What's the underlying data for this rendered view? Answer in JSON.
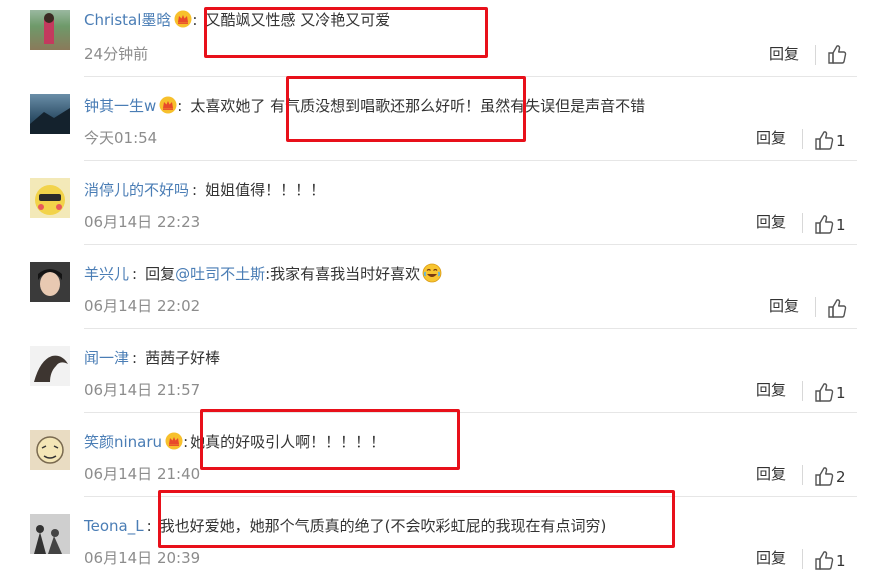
{
  "comments": [
    {
      "user": "Christal墨晗",
      "crown": true,
      "text": "又酷飒又性感 又冷艳又可爱",
      "time": "24分钟前",
      "reply": "回复",
      "likes": ""
    },
    {
      "user": "钟其一生w",
      "crown": true,
      "text": "太喜欢她了  有气质没想到唱歌还那么好听！虽然有失误但是声音不错",
      "time": "今天01:54",
      "reply": "回复",
      "likes": "1"
    },
    {
      "user": "消停儿的不好吗",
      "crown": false,
      "text": "姐姐值得！！！！",
      "time": "06月14日 22:23",
      "reply": "回复",
      "likes": "1"
    },
    {
      "user": "羊兴儿",
      "crown": false,
      "reply_prefix": "回复",
      "mention": "@吐司不土斯",
      "text": ":我家有喜我当时好喜欢",
      "emoji": "laugh-cry-emoji",
      "time": "06月14日 22:02",
      "reply": "回复",
      "likes": ""
    },
    {
      "user": "闻一津",
      "crown": false,
      "text": "茜茜子好棒",
      "time": "06月14日 21:57",
      "reply": "回复",
      "likes": "1"
    },
    {
      "user": "笑颜ninaru",
      "crown": true,
      "text": "她真的好吸引人啊！！！！！",
      "time": "06月14日 21:40",
      "reply": "回复",
      "likes": "2"
    },
    {
      "user": "Teona_L",
      "crown": false,
      "text": "我也好爱她，她那个气质真的绝了(不会吹彩虹屁的我现在有点词穷)",
      "time": "06月14日 20:39",
      "reply": "回复",
      "likes": "1"
    }
  ],
  "colors": {
    "username": "#4a7db5",
    "highlight_box": "#e8101a",
    "time": "#8c8c8c"
  }
}
